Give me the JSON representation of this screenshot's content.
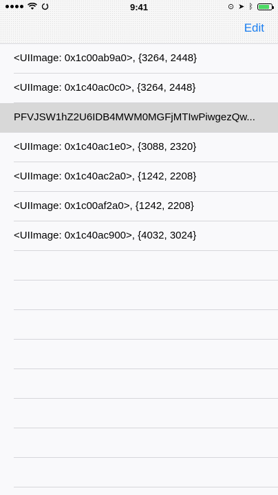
{
  "status_bar": {
    "time": "9:41",
    "battery_level": 0.85
  },
  "nav": {
    "edit_label": "Edit"
  },
  "rows": [
    {
      "text": "<UIImage: 0x1c00ab9a0>, {3264, 2448}",
      "selected": false
    },
    {
      "text": "<UIImage: 0x1c40ac0c0>, {3264, 2448}",
      "selected": false
    },
    {
      "text": "PFVJSW1hZ2U6IDB4MWM0MGFjMTIwPiwgezQw...",
      "selected": true
    },
    {
      "text": "<UIImage: 0x1c40ac1e0>, {3088, 2320}",
      "selected": false
    },
    {
      "text": "<UIImage: 0x1c40ac2a0>, {1242, 2208}",
      "selected": false
    },
    {
      "text": "<UIImage: 0x1c00af2a0>, {1242, 2208}",
      "selected": false
    },
    {
      "text": "<UIImage: 0x1c40ac900>, {4032, 3024}",
      "selected": false
    },
    {
      "text": "",
      "selected": false
    },
    {
      "text": "",
      "selected": false
    },
    {
      "text": "",
      "selected": false
    },
    {
      "text": "",
      "selected": false
    },
    {
      "text": "",
      "selected": false
    },
    {
      "text": "",
      "selected": false
    },
    {
      "text": "",
      "selected": false
    },
    {
      "text": "",
      "selected": false
    }
  ]
}
